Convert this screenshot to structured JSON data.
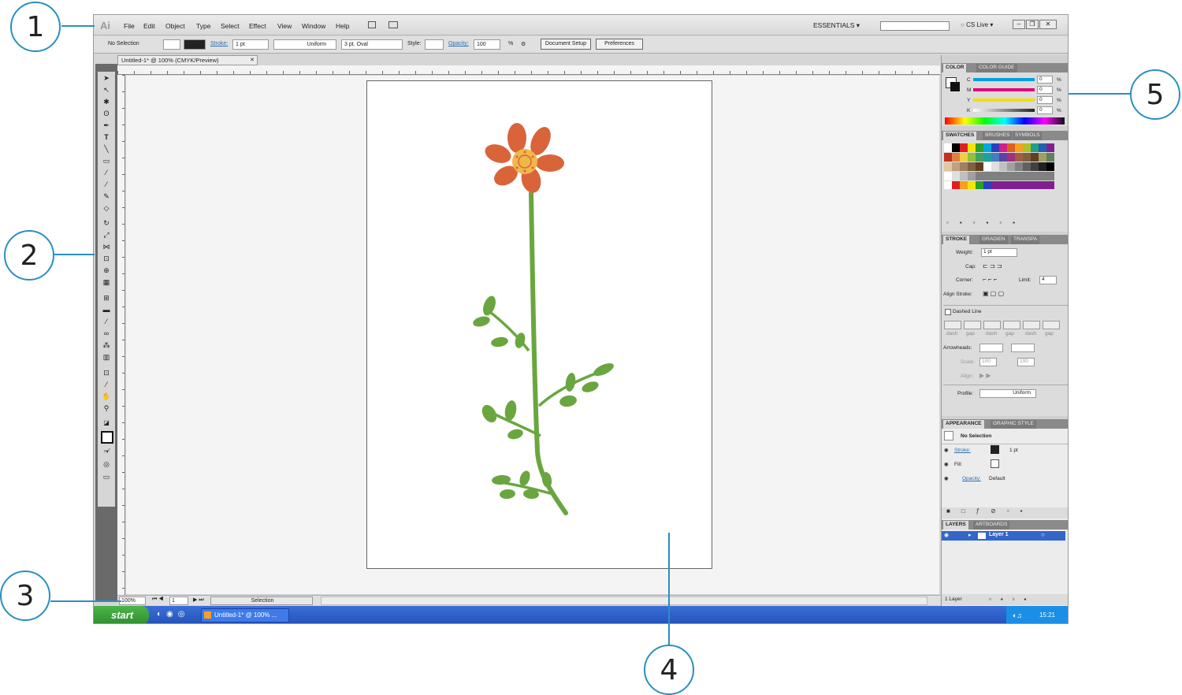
{
  "callouts": [
    "1",
    "2",
    "3",
    "4",
    "5"
  ],
  "menubar": {
    "logo": "Ai",
    "items": [
      "File",
      "Edit",
      "Object",
      "Type",
      "Select",
      "Effect",
      "View",
      "Window",
      "Help"
    ],
    "workspace": "ESSENTIALS",
    "cslive": "CS Live"
  },
  "controlbar": {
    "selection": "No Selection",
    "stroke_label": "Stroke:",
    "stroke_value": "1 pt",
    "profile": "Uniform",
    "brush": "3 pt. Oval",
    "style_label": "Style:",
    "opacity_label": "Opacity:",
    "opacity_value": "100",
    "opacity_unit": "%",
    "document_setup": "Document Setup",
    "preferences": "Preferences"
  },
  "document": {
    "tab_title": "Untitled-1* @ 100% (CMYK/Preview)"
  },
  "statusbar": {
    "zoom": "100%",
    "artboard": "1",
    "mode": "Selection"
  },
  "panels": {
    "color": {
      "tabs": [
        "COLOR",
        "COLOR GUIDE"
      ],
      "channels": [
        {
          "name": "C",
          "value": "0",
          "unit": "%",
          "color": "#00a0e0"
        },
        {
          "name": "M",
          "value": "0",
          "unit": "%",
          "color": "#e0007a"
        },
        {
          "name": "Y",
          "value": "0",
          "unit": "%",
          "color": "#f0e000"
        },
        {
          "name": "K",
          "value": "0",
          "unit": "%",
          "color": "#222222"
        }
      ]
    },
    "swatches": {
      "tabs": [
        "SWATCHES",
        "BRUSHES",
        "SYMBOLS"
      ]
    },
    "stroke": {
      "tabs": [
        "STROKE",
        "GRADIEN",
        "TRANSPA"
      ],
      "weight_label": "Weight:",
      "weight_value": "1 pt",
      "cap_label": "Cap:",
      "corner_label": "Corner:",
      "limit_label": "Limit:",
      "limit_value": "4",
      "align_label": "Align Stroke:",
      "dashed_label": "Dashed Line",
      "dash_labels": [
        "dash",
        "gap",
        "dash",
        "gap",
        "dash",
        "gap"
      ],
      "arrowheads_label": "Arrowheads:",
      "scale_label": "Scale:",
      "scale_value": "100",
      "align_arrow_label": "Align:",
      "profile_label": "Profile:",
      "profile_value": "Uniform"
    },
    "appearance": {
      "tabs": [
        "APPEARANCE",
        "GRAPHIC STYLE"
      ],
      "header": "No Selection",
      "rows": [
        {
          "label": "Stroke:",
          "value": "1 pt"
        },
        {
          "label": "Fill:",
          "value": ""
        },
        {
          "label": "Opacity:",
          "value": "Default"
        }
      ]
    },
    "layers": {
      "tabs": [
        "LAYERS",
        "ARTBOARDS"
      ],
      "layer_name": "Layer 1",
      "footer": "1 Layer"
    }
  },
  "taskbar": {
    "start": "start",
    "task": "Untitled-1* @ 100% ...",
    "clock": "15:21"
  },
  "colors": {
    "callout_blue": "#2a8fc2",
    "petal": "#d9643a",
    "flower_center": "#f0b84a",
    "stem": "#6aa640",
    "layer_highlight": "#3266c8"
  }
}
